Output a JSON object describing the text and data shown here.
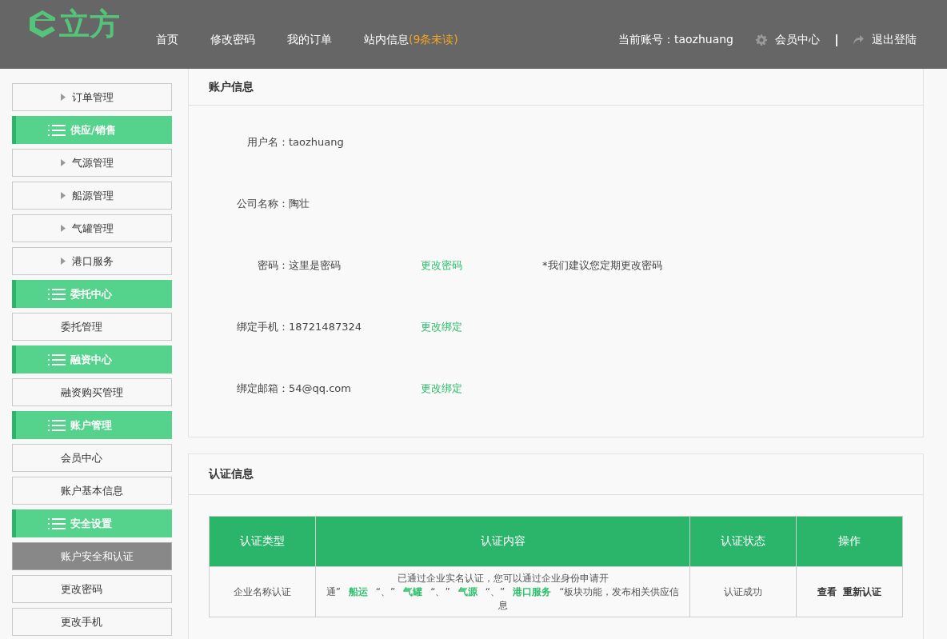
{
  "header": {
    "logo_text": "立方",
    "nav": [
      {
        "label": "首页"
      },
      {
        "label": "修改密码"
      },
      {
        "label": "我的订单"
      },
      {
        "label": "站内信息",
        "badge": "(9条未读)"
      }
    ],
    "account": "当前账号：taozhuang",
    "member_link": "会员中心",
    "logout_link": "退出登陆"
  },
  "sidebar": [
    {
      "kind": "item",
      "label": "订单管理",
      "arrow": true,
      "selected": false
    },
    {
      "kind": "group",
      "label": "供应/销售"
    },
    {
      "kind": "item",
      "label": "气源管理",
      "arrow": true,
      "selected": false
    },
    {
      "kind": "item",
      "label": "船源管理",
      "arrow": true,
      "selected": false
    },
    {
      "kind": "item",
      "label": "气罐管理",
      "arrow": true,
      "selected": false
    },
    {
      "kind": "item",
      "label": "港口服务",
      "arrow": true,
      "selected": false
    },
    {
      "kind": "group",
      "label": "委托中心"
    },
    {
      "kind": "item",
      "label": "委托管理",
      "arrow": false,
      "selected": false
    },
    {
      "kind": "group",
      "label": "融资中心"
    },
    {
      "kind": "item",
      "label": "融资购买管理",
      "arrow": false,
      "selected": false
    },
    {
      "kind": "group",
      "label": "账户管理"
    },
    {
      "kind": "item",
      "label": "会员中心",
      "arrow": false,
      "selected": false
    },
    {
      "kind": "item",
      "label": "账户基本信息",
      "arrow": false,
      "selected": false
    },
    {
      "kind": "group",
      "label": "安全设置"
    },
    {
      "kind": "item",
      "label": "账户安全和认证",
      "arrow": false,
      "selected": true
    },
    {
      "kind": "item",
      "label": "更改密码",
      "arrow": false,
      "selected": false
    },
    {
      "kind": "item",
      "label": "更改手机",
      "arrow": false,
      "selected": false
    }
  ],
  "account_panel": {
    "title": "账户信息",
    "rows": [
      {
        "label": "用户名：",
        "value": "taozhuang"
      },
      {
        "label": "公司名称：",
        "value": "陶壮"
      },
      {
        "label": "密码：",
        "value": "这里是密码",
        "link": "更改密码",
        "note": "*我们建议您定期更改密码"
      },
      {
        "label": "绑定手机：",
        "value": "18721487324",
        "link": "更改绑定"
      },
      {
        "label": "绑定邮箱：",
        "value": "54@qq.com",
        "link": "更改绑定"
      }
    ]
  },
  "cert_panel": {
    "title": "认证信息",
    "table": {
      "columns": [
        "认证类型",
        "认证内容",
        "认证状态",
        "操作"
      ],
      "rows": [
        {
          "type": "企业名称认证",
          "content": [
            {
              "kind": "text",
              "text": "已通过企业实名认证，您可以通过企业身份申请开通”"
            },
            {
              "kind": "link",
              "text": "船运"
            },
            {
              "kind": "text",
              "text": "“、”"
            },
            {
              "kind": "link",
              "text": "气罐"
            },
            {
              "kind": "text",
              "text": "“、”"
            },
            {
              "kind": "link",
              "text": "气源"
            },
            {
              "kind": "text",
              "text": "“、”"
            },
            {
              "kind": "link",
              "text": "港口服务"
            },
            {
              "kind": "text",
              "text": "“板块功能，发布相关供应信息"
            }
          ],
          "status": "认证成功",
          "actions": [
            "查看",
            "重新认证"
          ]
        }
      ]
    }
  }
}
